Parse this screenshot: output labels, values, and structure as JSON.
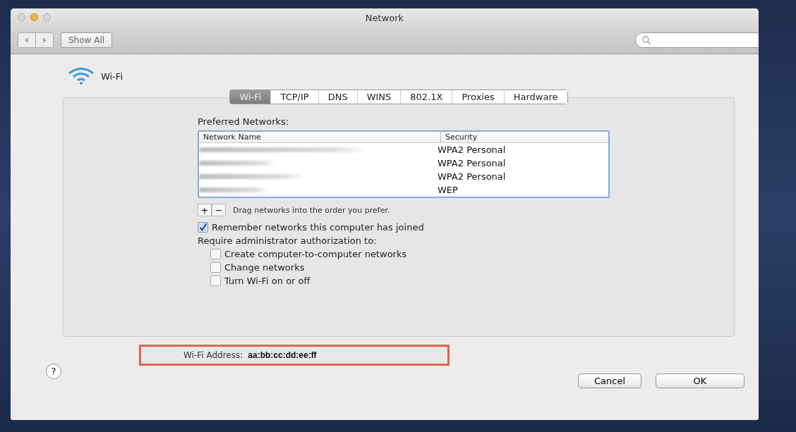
{
  "window": {
    "title": "Network"
  },
  "toolbar": {
    "show_all": "Show All"
  },
  "service": {
    "name": "Wi-Fi"
  },
  "tabs": [
    {
      "label": "Wi-Fi",
      "selected": true
    },
    {
      "label": "TCP/IP",
      "selected": false
    },
    {
      "label": "DNS",
      "selected": false
    },
    {
      "label": "WINS",
      "selected": false
    },
    {
      "label": "802.1X",
      "selected": false
    },
    {
      "label": "Proxies",
      "selected": false
    },
    {
      "label": "Hardware",
      "selected": false
    }
  ],
  "preferred_networks": {
    "label": "Preferred Networks:",
    "columns": [
      "Network Name",
      "Security"
    ],
    "rows": [
      {
        "security": "WPA2 Personal"
      },
      {
        "security": "WPA2 Personal"
      },
      {
        "security": "WPA2 Personal"
      },
      {
        "security": "WEP"
      }
    ],
    "add": "+",
    "remove": "−",
    "hint": "Drag networks into the order you prefer."
  },
  "remember": {
    "label": "Remember networks this computer has joined",
    "checked": true
  },
  "require_label": "Require administrator authorization to:",
  "require_options": [
    {
      "label": "Create computer-to-computer networks",
      "checked": false
    },
    {
      "label": "Change networks",
      "checked": false
    },
    {
      "label": "Turn Wi-Fi on or off",
      "checked": false
    }
  ],
  "address": {
    "label": "Wi-Fi Address:",
    "value": "aa:bb:cc:dd:ee:ff"
  },
  "buttons": {
    "help": "?",
    "cancel": "Cancel",
    "ok": "OK"
  }
}
